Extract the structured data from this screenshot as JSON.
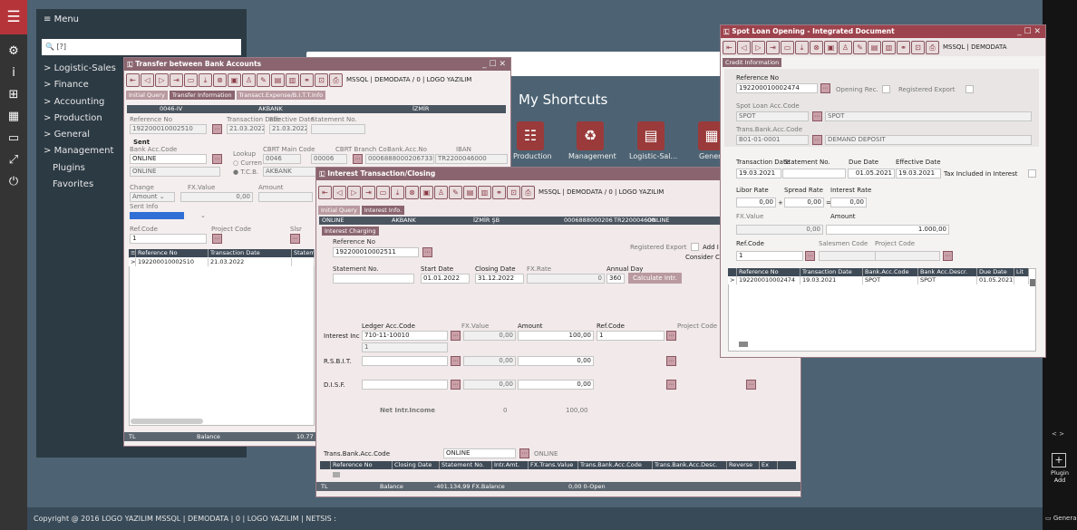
{
  "menu": {
    "title": "Menu",
    "search": "[?]",
    "items": [
      "Logistic-Sales",
      "Finance",
      "Accounting",
      "Production",
      "General",
      "Management",
      "Plugins",
      "Favorites"
    ]
  },
  "shortcuts": {
    "title": "My Shortcuts",
    "items": [
      "Production",
      "Management",
      "Logistic-Sal...",
      "Genera"
    ]
  },
  "footer": "Copyright @ 2016 LOGO YAZILIM MSSQL | DEMODATA | 0 | LOGO YAZILIM | NETSIS :",
  "right_rail": {
    "plugin": "Plugin\nAdd",
    "general": "General",
    "arrows": "<  >"
  },
  "conn": "MSSQL | DEMODATA / 0 | LOGO YAZILIM",
  "conn_short": "MSSQL | DEMODATA",
  "w1": {
    "title": "Transfer between Bank Accounts",
    "tabs": [
      "Initial Query",
      "Transfer Information",
      "Transact.Expense/B.I.T.T.Info"
    ],
    "band": {
      "code": "0046-IV",
      "bank": "AKBANK",
      "city": "İZMİR"
    },
    "ref_label": "Reference No",
    "ref": "192200010002510",
    "tdate_label": "Transaction Date",
    "tdate": "21.03.2022",
    "edate_label": "Effective Date",
    "edate": "21.03.2022",
    "stmt_label": "Statement No.",
    "sent": "Sent",
    "bankacc_label": "Bank Acc.Code",
    "bankacc": "ONLINE",
    "bankacc2": "ONLINE",
    "lookup": "Lookup",
    "currency": "Curren",
    "tcb": "T.C.B.",
    "cbrt_label": "CBRT Main Code",
    "cbrt": "0046",
    "akbank": "AKBANK",
    "branch_label": "CBRT Branch Co",
    "branch": "00006",
    "bankaccno_label": "Bank.Acc.No",
    "bankaccno": "0006888000206733",
    "iban_label": "IBAN",
    "iban": "TR2200046000",
    "change_label": "Change",
    "change": "Amount",
    "fxval_label": "FX.Value",
    "fxval": "0,00",
    "amount_label": "Amount",
    "sentinfo_label": "Sent Info",
    "refcode_label": "Ref.Code",
    "refcode": "1",
    "proj_label": "Project Code",
    "slr_label": "Slsr",
    "grid": {
      "cols": [
        "Reference No",
        "Transaction Date",
        "Statem"
      ],
      "rows": [
        [
          "192200010002510",
          "21.03.2022",
          ""
        ]
      ]
    },
    "status": {
      "cur": "TL",
      "label": "Balance",
      "val": "10.77"
    }
  },
  "w2": {
    "title": "Interest Transaction/Closing",
    "tabs": [
      "Initial Query",
      "Interest Info."
    ],
    "band": {
      "acc": "ONLINE",
      "bank": "AKBANK",
      "city": "İZMİR ŞB",
      "no": "0006888000206",
      "iban": "TR220004600",
      "acc2": "ONLINE"
    },
    "section": "Interest Charging",
    "ref_label": "Reference No",
    "ref": "192200010002511",
    "regexp": "Registered Export",
    "add": "Add I",
    "consider": "Consider C",
    "stmt_label": "Statement No.",
    "start_label": "Start Date",
    "start": "01.01.2022",
    "close_label": "Closing Date",
    "close": "31.12.2022",
    "fx_label": "FX.Rate",
    "fx": "0",
    "annual_label": "Annual Day",
    "annual": "360",
    "calc": "Calculate Intr.",
    "hdr": {
      "ledger": "Ledger Acc.Code",
      "fx": "FX.Value",
      "amount": "Amount",
      "ref": "Ref.Code",
      "proj": "Project Code"
    },
    "rows": [
      {
        "label": "Interest Inc",
        "code": "710-11-10010",
        "fx": "0,00",
        "amount": "100,00",
        "ref": "1",
        "sub": "1"
      },
      {
        "label": "R.S.B.I.T.",
        "code": "",
        "fx": "0,00",
        "amount": "0,00",
        "ref": "",
        "sub": ""
      },
      {
        "label": "D.I.S.F.",
        "code": "",
        "fx": "0,00",
        "amount": "0,00",
        "ref": "",
        "sub": ""
      }
    ],
    "net_label": "Net Intr.Income",
    "net_fx": "0",
    "net_amount": "100,00",
    "tba_label": "Trans.Bank.Acc.Code",
    "tba": "ONLINE",
    "tba2": "ONLINE",
    "grid_cols": [
      "Reference No",
      "Closing Date",
      "Statement No.",
      "Intr.Amt.",
      "FX.Trans.Value",
      "Trans.Bank.Acc.Code",
      "Trans.Bank.Acc.Desc.",
      "Reverse",
      "Ex"
    ],
    "status": {
      "cur": "TL",
      "label": "Balance",
      "val": "-401.134,99 FX.Balance",
      "val2": "0,00 0-Open"
    }
  },
  "w3": {
    "title": "Spot Loan Opening - Integrated Document",
    "tabs": [
      "Credit Information"
    ],
    "ref_label": "Reference No",
    "ref": "192200010002474",
    "opening": "Opening Rec.",
    "regexp": "Registered Export",
    "spot_label": "Spot Loan Acc.Code",
    "spot": "SPOT",
    "spot2": "SPOT",
    "tba_label": "Trans.Bank.Acc.Code",
    "tba": "B01-01-0001",
    "tba2": "DEMAND DEPOSIT",
    "tdate_label": "Transaction Date",
    "tdate": "19.03.2021",
    "stmt_label": "Statement No.",
    "due_label": "Due Date",
    "due": "01.05.2021",
    "eff_label": "Effective Date",
    "eff": "19.03.2021",
    "tax": "Tax Included in Interest",
    "libor_label": "Libor Rate",
    "libor": "0,00",
    "plus": "+",
    "spread_label": "Spread Rate",
    "spread": "0,00",
    "eq": "=",
    "ir_label": "Interest Rate",
    "ir": "0,00",
    "fxv_label": "FX.Value",
    "fxv": "0,00",
    "amt_label": "Amount",
    "amt": "1.000,00",
    "refcode_label": "Ref.Code",
    "refcode": "1",
    "sales_label": "Salesmen Code",
    "proj_label": "Project Code",
    "grid": {
      "cols": [
        "Reference No",
        "Transaction Date",
        "Bank.Acc.Code",
        "Bank Acc.Descr.",
        "Due Date",
        "Lit"
      ],
      "rows": [
        [
          "192200010002474",
          "19.03.2021",
          "SPOT",
          "SPOT",
          "01.05.2021",
          ""
        ]
      ]
    }
  }
}
